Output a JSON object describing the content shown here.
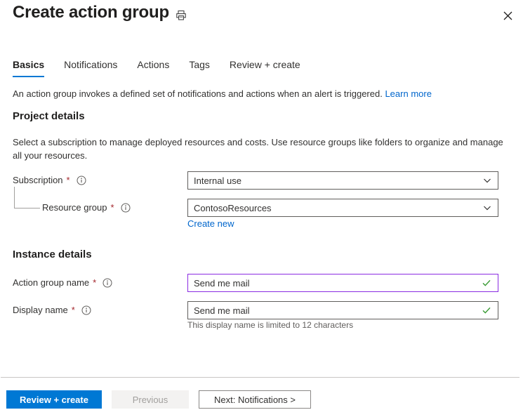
{
  "header": {
    "title": "Create action group",
    "print_icon": "printer-icon",
    "close_icon": "close-icon"
  },
  "tabs": [
    {
      "label": "Basics",
      "active": true
    },
    {
      "label": "Notifications",
      "active": false
    },
    {
      "label": "Actions",
      "active": false
    },
    {
      "label": "Tags",
      "active": false
    },
    {
      "label": "Review + create",
      "active": false
    }
  ],
  "intro": {
    "text": "An action group invokes a defined set of notifications and actions when an alert is triggered.",
    "link_label": "Learn more"
  },
  "project_details": {
    "heading": "Project details",
    "description": "Select a subscription to manage deployed resources and costs. Use resource groups like folders to organize and manage all your resources.",
    "subscription": {
      "label": "Subscription",
      "required_marker": "*",
      "info_icon": "info-icon",
      "value": "Internal use",
      "chevron_icon": "chevron-down-icon"
    },
    "resource_group": {
      "label": "Resource group",
      "required_marker": "*",
      "info_icon": "info-icon",
      "value": "ContosoResources",
      "chevron_icon": "chevron-down-icon",
      "create_new_label": "Create new"
    }
  },
  "instance_details": {
    "heading": "Instance details",
    "action_group_name": {
      "label": "Action group name",
      "required_marker": "*",
      "info_icon": "info-icon",
      "value": "Send me mail",
      "validation_icon": "checkmark-icon"
    },
    "display_name": {
      "label": "Display name",
      "required_marker": "*",
      "info_icon": "info-icon",
      "value": "Send me mail",
      "validation_icon": "checkmark-icon",
      "hint": "This display name is limited to 12 characters"
    }
  },
  "footer": {
    "review_create_label": "Review + create",
    "previous_label": "Previous",
    "next_label": "Next: Notifications >"
  },
  "colors": {
    "accent": "#0078d4",
    "link": "#0066cc",
    "required": "#a4262c",
    "focus_border": "#8a2be2",
    "success": "#3a9b35"
  }
}
